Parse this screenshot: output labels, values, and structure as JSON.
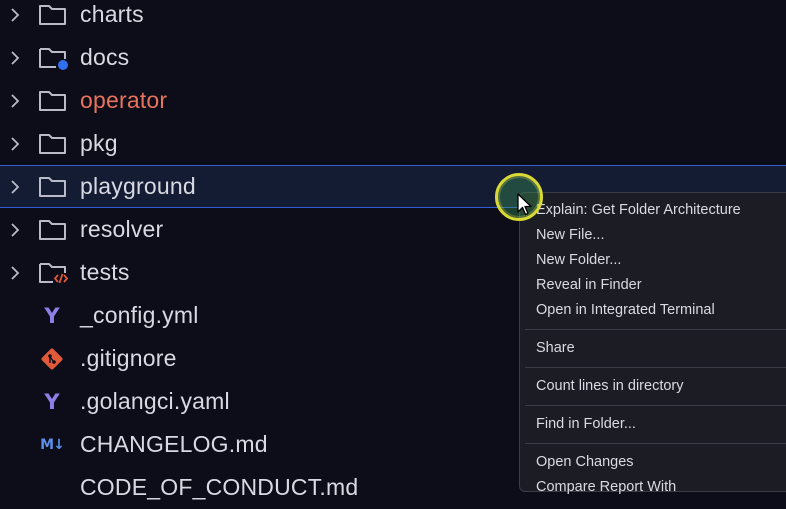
{
  "explorer": {
    "items": [
      {
        "label": "charts",
        "kind": "folder",
        "color": "#d8dae3"
      },
      {
        "label": "docs",
        "kind": "folder-dot",
        "color": "#d8dae3"
      },
      {
        "label": "operator",
        "kind": "folder",
        "color": "#e8735c"
      },
      {
        "label": "pkg",
        "kind": "folder",
        "color": "#d8dae3"
      },
      {
        "label": "playground",
        "kind": "folder",
        "color": "#d8dae3",
        "selected": true
      },
      {
        "label": "resolver",
        "kind": "folder",
        "color": "#d8dae3"
      },
      {
        "label": "tests",
        "kind": "folder-code",
        "color": "#d8dae3"
      },
      {
        "label": "_config.yml",
        "kind": "yaml",
        "icon_text": "Y"
      },
      {
        "label": ".gitignore",
        "kind": "git"
      },
      {
        "label": ".golangci.yaml",
        "kind": "yaml",
        "icon_text": "Y"
      },
      {
        "label": "CHANGELOG.md",
        "kind": "markdown",
        "icon_text": "M↓"
      },
      {
        "label": "CODE_OF_CONDUCT.md",
        "kind": "markdown"
      }
    ]
  },
  "context_menu": {
    "groups": [
      [
        "Explain: Get Folder Architecture",
        "New File...",
        "New Folder...",
        "Reveal in Finder",
        "Open in Integrated Terminal"
      ],
      [
        "Share"
      ],
      [
        "Count lines in directory"
      ],
      [
        "Find in Folder..."
      ],
      [
        "Open Changes",
        "Compare Report With"
      ]
    ]
  },
  "colors": {
    "background": "#0c0d18",
    "selection_border": "#2f5fd0",
    "warning_text": "#e8735c",
    "docs_dot": "#2f6ff0",
    "git_icon": "#e05a3a"
  }
}
